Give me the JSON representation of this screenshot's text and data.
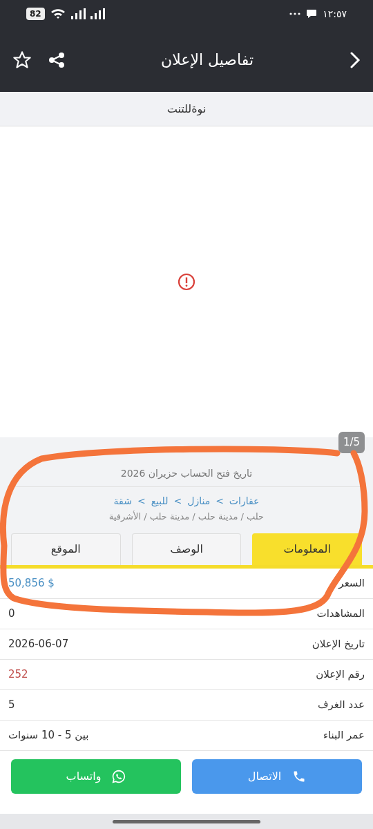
{
  "status_bar": {
    "time": "١٢:٥٧",
    "battery": "82"
  },
  "header": {
    "title": "تفاصيل الإعلان"
  },
  "subtitle": "نوةللتنت",
  "gallery": {
    "counter": "1/5"
  },
  "info": {
    "account_date": "تاريخ فتح الحساب حزيران 2026",
    "breadcrumb": {
      "separator": ">",
      "items": [
        "عقارات",
        "منازل",
        "للبيع",
        "شقة"
      ]
    },
    "location": "حلب / مدينة حلب / مدينة حلب / الأشرفية"
  },
  "tabs": [
    {
      "label": "المعلومات",
      "selected": true
    },
    {
      "label": "الوصف",
      "selected": false
    },
    {
      "label": "الموقع",
      "selected": false
    }
  ],
  "details": [
    {
      "label": "السعر",
      "value": "$ 50,856",
      "kind": "price"
    },
    {
      "label": "المشاهدات",
      "value": "0",
      "kind": "plain"
    },
    {
      "label": "تاريخ الإعلان",
      "value": "2026-06-07",
      "kind": "plain"
    },
    {
      "label": "رقم الإعلان",
      "value": "252",
      "kind": "id"
    },
    {
      "label": "عدد الغرف",
      "value": "5",
      "kind": "plain"
    },
    {
      "label": "عمر البناء",
      "value": "بين 5 - 10 سنوات",
      "kind": "plain"
    }
  ],
  "buttons": [
    {
      "label": "الاتصال",
      "kind": "call"
    },
    {
      "label": "واتساب",
      "kind": "whatsapp"
    }
  ]
}
